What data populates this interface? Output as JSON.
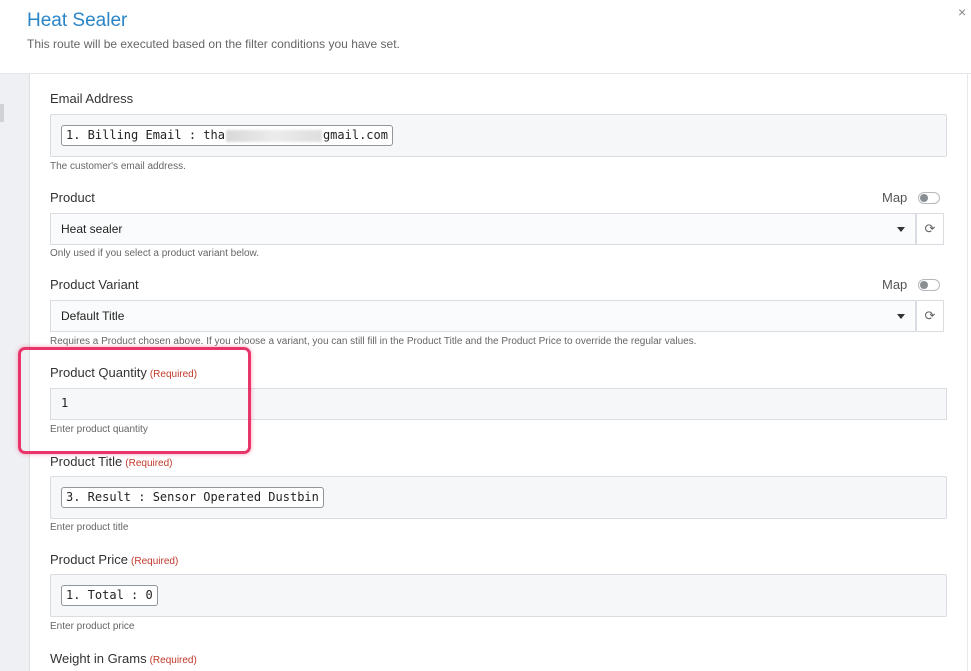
{
  "modal": {
    "title": "Heat Sealer",
    "subtitle": "This route will be executed based on the filter conditions you have set.",
    "close_icon": "×"
  },
  "fields": {
    "email": {
      "label": "Email Address",
      "token_prefix": "1. Billing Email : tha",
      "token_suffix": "gmail.com",
      "hint": "The customer's email address."
    },
    "product": {
      "label": "Product",
      "map_label": "Map",
      "value": "Heat sealer",
      "hint": "Only used if you select a product variant below.",
      "refresh_icon": "⟳"
    },
    "variant": {
      "label": "Product Variant",
      "map_label": "Map",
      "value": "Default Title",
      "hint": "Requires a Product chosen above. If you choose a variant, you can still fill in the Product Title and the Product Price to override the regular values.",
      "refresh_icon": "⟳"
    },
    "quantity": {
      "label": "Product Quantity",
      "required": "(Required)",
      "value": "1",
      "hint": "Enter product quantity"
    },
    "title": {
      "label": "Product Title",
      "required": "(Required)",
      "token": "3. Result : Sensor Operated Dustbin",
      "hint": "Enter product title"
    },
    "price": {
      "label": "Product Price",
      "required": "(Required)",
      "token": "1. Total : 0",
      "hint": "Enter product price"
    },
    "weight": {
      "label": "Weight in Grams",
      "required": "(Required)"
    }
  },
  "colors": {
    "title_blue": "#2a85c8",
    "required_red": "#c0392b",
    "highlight_pink": "#e8356a"
  }
}
